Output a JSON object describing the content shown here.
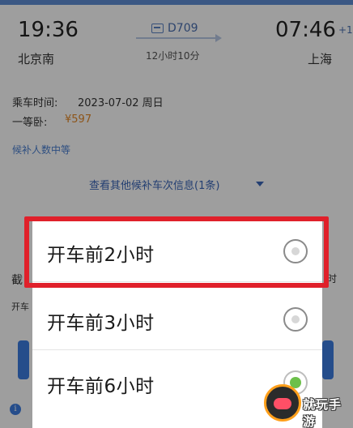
{
  "ticket": {
    "depart_time": "19:36",
    "depart_station": "北京南",
    "train_no": "D709",
    "duration": "12小时10分",
    "arrive_time": "07:46",
    "arrive_day_offset": "+1",
    "arrive_station": "上海"
  },
  "info": {
    "date_label": "乘车时间:",
    "date_value": "2023-07-02 周日",
    "seat_label": "一等卧:",
    "price": "¥597",
    "waitlist_status": "候补人数中等",
    "other_trains_link": "查看其他候补车次信息(1条)"
  },
  "background_fragments": {
    "left_a": "截",
    "left_b": "开车",
    "right_a": "时"
  },
  "deadline_options": [
    {
      "label": "开车前2小时",
      "selected": false,
      "highlighted": true
    },
    {
      "label": "开车前3小时",
      "selected": false,
      "highlighted": false
    },
    {
      "label": "开车前6小时",
      "selected": true,
      "highlighted": false
    }
  ],
  "watermark": {
    "text": "就玩手游",
    "icon": "gamepad-icon"
  },
  "colors": {
    "accent_blue": "#3c7de0",
    "price_orange": "#e48a2a",
    "highlight_red": "#e0202a",
    "selected_green": "#6cc04a"
  }
}
